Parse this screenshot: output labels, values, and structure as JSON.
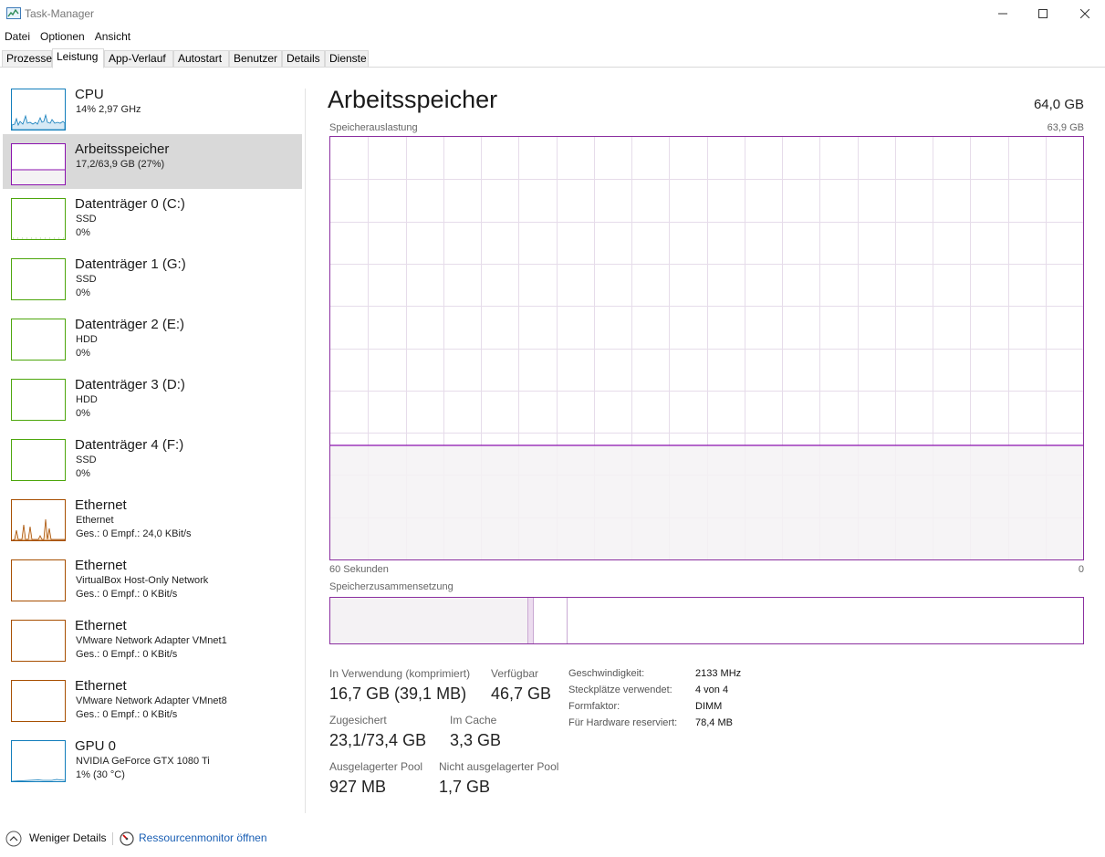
{
  "window": {
    "title": "Task-Manager"
  },
  "menu": [
    "Datei",
    "Optionen",
    "Ansicht"
  ],
  "tabs": [
    "Prozesse",
    "Leistung",
    "App-Verlauf",
    "Autostart",
    "Benutzer",
    "Details",
    "Dienste"
  ],
  "active_tab": "Leistung",
  "sidebar": [
    {
      "name": "CPU",
      "sub1": "14%  2,97 GHz",
      "sub2": "",
      "color": "#117dbb",
      "selected": false
    },
    {
      "name": "Arbeitsspeicher",
      "sub1": "17,2/63,9 GB (27%)",
      "sub2": "",
      "color": "#8b12ae",
      "selected": true
    },
    {
      "name": "Datenträger 0 (C:)",
      "sub1": "SSD",
      "sub2": "0%",
      "color": "#4da60c",
      "selected": false
    },
    {
      "name": "Datenträger 1 (G:)",
      "sub1": "SSD",
      "sub2": "0%",
      "color": "#4da60c",
      "selected": false
    },
    {
      "name": "Datenträger 2 (E:)",
      "sub1": "HDD",
      "sub2": "0%",
      "color": "#4da60c",
      "selected": false
    },
    {
      "name": "Datenträger 3 (D:)",
      "sub1": "HDD",
      "sub2": "0%",
      "color": "#4da60c",
      "selected": false
    },
    {
      "name": "Datenträger 4 (F:)",
      "sub1": "SSD",
      "sub2": "0%",
      "color": "#4da60c",
      "selected": false
    },
    {
      "name": "Ethernet",
      "sub1": "Ethernet",
      "sub2": "Ges.: 0  Empf.: 24,0 KBit/s",
      "color": "#a74f01",
      "selected": false
    },
    {
      "name": "Ethernet",
      "sub1": "VirtualBox Host-Only Network",
      "sub2": "Ges.: 0  Empf.: 0 KBit/s",
      "color": "#a74f01",
      "selected": false
    },
    {
      "name": "Ethernet",
      "sub1": "VMware Network Adapter VMnet1",
      "sub2": "Ges.: 0  Empf.: 0 KBit/s",
      "color": "#a74f01",
      "selected": false
    },
    {
      "name": "Ethernet",
      "sub1": "VMware Network Adapter VMnet8",
      "sub2": "Ges.: 0  Empf.: 0 KBit/s",
      "color": "#a74f01",
      "selected": false
    },
    {
      "name": "GPU 0",
      "sub1": "NVIDIA GeForce GTX 1080 Ti",
      "sub2": "1% (30 °C)",
      "color": "#117dbb",
      "selected": false
    }
  ],
  "main": {
    "title": "Arbeitsspeicher",
    "total": "64,0 GB",
    "usage_label": "Speicherauslastung",
    "usage_max": "63,9 GB",
    "time_label": "60 Sekunden",
    "time_end": "0",
    "composition_label": "Speicherzusammensetzung",
    "usage_percent": 27,
    "stats": {
      "in_use_label": "In Verwendung (komprimiert)",
      "in_use_value": "16,7 GB (39,1 MB)",
      "available_label": "Verfügbar",
      "available_value": "46,7 GB",
      "committed_label": "Zugesichert",
      "committed_value": "23,1/73,4 GB",
      "cached_label": "Im Cache",
      "cached_value": "3,3 GB",
      "paged_label": "Ausgelagerter Pool",
      "paged_value": "927 MB",
      "nonpaged_label": "Nicht ausgelagerter Pool",
      "nonpaged_value": "1,7 GB"
    },
    "details": [
      {
        "label": "Geschwindigkeit:",
        "value": "2133 MHz"
      },
      {
        "label": "Steckplätze verwendet:",
        "value": "4 von 4"
      },
      {
        "label": "Formfaktor:",
        "value": "DIMM"
      },
      {
        "label": "Für Hardware reserviert:",
        "value": "78,4 MB"
      }
    ]
  },
  "footer": {
    "less_details": "Weniger Details",
    "resource_monitor": "Ressourcenmonitor öffnen"
  },
  "colors": {
    "memory": "#8b12ae",
    "cpu": "#117dbb",
    "disk": "#4da60c",
    "network": "#a74f01",
    "selection": "#d9d9d9",
    "link": "#1a5fb4"
  },
  "icons": [
    "task-manager-icon",
    "minimize-icon",
    "maximize-icon",
    "close-icon",
    "chevron-up-icon",
    "resource-monitor-icon"
  ]
}
